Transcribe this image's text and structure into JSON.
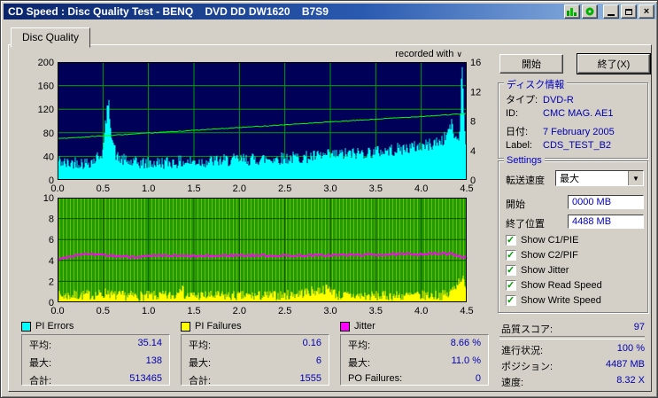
{
  "window": {
    "title": "CD Speed : Disc Quality Test - BENQ    DVD DD DW1620    B7S9"
  },
  "tab": {
    "label": "Disc Quality"
  },
  "chart_note": "recorded with",
  "buttons": {
    "start": "開始",
    "exit": "終了(X)"
  },
  "disc_info": {
    "title": "ディスク情報",
    "rows": [
      {
        "label": "タイプ:",
        "value": "DVD-R"
      },
      {
        "label": "ID:",
        "value": "CMC MAG. AE1"
      },
      {
        "label": "日付:",
        "value": "7 February 2005"
      },
      {
        "label": "Label:",
        "value": "CDS_TEST_B2"
      }
    ]
  },
  "settings": {
    "title": "Settings",
    "speed_label": "転送速度",
    "speed_value": "最大",
    "start_label": "開始",
    "start_value": "0000 MB",
    "end_label": "終了位置",
    "end_value": "4488 MB",
    "checkboxes": [
      {
        "label": "Show C1/PIE",
        "checked": true
      },
      {
        "label": "Show C2/PIF",
        "checked": true
      },
      {
        "label": "Show Jitter",
        "checked": true
      },
      {
        "label": "Show Read Speed",
        "checked": true
      },
      {
        "label": "Show Write Speed",
        "checked": true
      }
    ]
  },
  "status": {
    "quality_label": "品質スコア:",
    "quality_value": "97",
    "progress_label": "進行状況:",
    "progress_value": "100 %",
    "position_label": "ポジション:",
    "position_value": "4487 MB",
    "speed_label": "速度:",
    "speed_value": "8.32 X"
  },
  "stats": [
    {
      "name": "PI Errors",
      "color": "#00ffff",
      "rows": [
        {
          "label": "平均:",
          "value": "35.14"
        },
        {
          "label": "最大:",
          "value": "138"
        },
        {
          "label": "合計:",
          "value": "513465"
        }
      ]
    },
    {
      "name": "PI Failures",
      "color": "#ffff00",
      "rows": [
        {
          "label": "平均:",
          "value": "0.16"
        },
        {
          "label": "最大:",
          "value": "6"
        },
        {
          "label": "合計:",
          "value": "1555"
        }
      ]
    },
    {
      "name": "Jitter",
      "color": "#ff00ff",
      "rows": [
        {
          "label": "平均:",
          "value": "8.66 %"
        },
        {
          "label": "最大:",
          "value": "11.0 %"
        },
        {
          "label": "PO Failures:",
          "value": "0"
        }
      ]
    }
  ],
  "chart_data": [
    {
      "type": "area",
      "name": "PI Errors and Write Speed vs position (GB)",
      "x_range": [
        0,
        4.5
      ],
      "x_ticks": [
        "0.0",
        "0.5",
        "1.0",
        "1.5",
        "2.0",
        "2.5",
        "3.0",
        "3.5",
        "4.0",
        "4.5"
      ],
      "y_left_range": [
        0,
        200
      ],
      "y_left_ticks": [
        0,
        40,
        80,
        120,
        160,
        200
      ],
      "y_right_range": [
        0,
        16
      ],
      "y_right_ticks": [
        0,
        4,
        8,
        12,
        16
      ],
      "colors": {
        "bg": "#000058",
        "grid": "#00a000",
        "label": "#000000"
      },
      "seed": 42,
      "series": [
        {
          "name": "PI Errors",
          "type": "spike-area",
          "color": "#00ffff",
          "noise": 11,
          "anchors": [
            [
              0,
              30
            ],
            [
              0.1,
              24
            ],
            [
              0.2,
              28
            ],
            [
              0.3,
              25
            ],
            [
              0.4,
              30
            ],
            [
              0.5,
              45
            ],
            [
              0.53,
              95
            ],
            [
              0.56,
              130
            ],
            [
              0.6,
              70
            ],
            [
              0.65,
              35
            ],
            [
              0.8,
              26
            ],
            [
              1.0,
              25
            ],
            [
              1.3,
              27
            ],
            [
              1.6,
              28
            ],
            [
              2.0,
              31
            ],
            [
              2.4,
              33
            ],
            [
              2.8,
              36
            ],
            [
              3.2,
              41
            ],
            [
              3.6,
              46
            ],
            [
              3.9,
              52
            ],
            [
              4.1,
              57
            ],
            [
              4.25,
              65
            ],
            [
              4.33,
              92
            ],
            [
              4.38,
              65
            ],
            [
              4.42,
              70
            ],
            [
              4.45,
              196
            ],
            [
              4.48,
              80
            ],
            [
              4.5,
              55
            ]
          ]
        },
        {
          "name": "Write Speed",
          "type": "line",
          "color": "#00ff00",
          "noise": 0.05,
          "range": [
            0,
            16
          ],
          "anchors": [
            [
              0,
              5.6
            ],
            [
              4.5,
              9.0
            ]
          ]
        }
      ]
    },
    {
      "type": "area",
      "name": "PI Failures and Jitter vs position (GB)",
      "x_range": [
        0,
        4.5
      ],
      "x_ticks": [
        "0.0",
        "0.5",
        "1.0",
        "1.5",
        "2.0",
        "2.5",
        "3.0",
        "3.5",
        "4.0",
        "4.5"
      ],
      "y_left_range": [
        0,
        10
      ],
      "y_left_ticks": [
        0,
        2,
        4,
        6,
        8,
        10
      ],
      "colors": {
        "bg": "#1e9c00",
        "grid": "#0c5200",
        "stripes": "#a8cf00",
        "label": "#000000"
      },
      "seed": 7,
      "series": [
        {
          "name": "PI Failures",
          "type": "spike-area",
          "color": "#ffff00",
          "noise": 0.5,
          "anchors": [
            [
              0,
              0.45
            ],
            [
              0.5,
              0.6
            ],
            [
              0.55,
              0.9
            ],
            [
              0.6,
              0.5
            ],
            [
              1.0,
              0.45
            ],
            [
              1.3,
              0.5
            ],
            [
              1.35,
              1.6
            ],
            [
              1.4,
              0.5
            ],
            [
              2.0,
              0.45
            ],
            [
              2.5,
              0.5
            ],
            [
              3.0,
              1.15
            ],
            [
              3.08,
              0.5
            ],
            [
              3.5,
              0.45
            ],
            [
              4.0,
              0.5
            ],
            [
              4.3,
              0.55
            ],
            [
              4.45,
              2.3
            ],
            [
              4.5,
              0.7
            ]
          ]
        },
        {
          "name": "Jitter",
          "type": "line",
          "color": "#ff00ff",
          "noise": 0.1,
          "width": 2,
          "anchors": [
            [
              0,
              4.15
            ],
            [
              0.25,
              4.6
            ],
            [
              0.5,
              4.5
            ],
            [
              0.8,
              4.35
            ],
            [
              1.2,
              4.45
            ],
            [
              1.6,
              4.4
            ],
            [
              2.0,
              4.5
            ],
            [
              2.5,
              4.45
            ],
            [
              3.0,
              4.5
            ],
            [
              3.5,
              4.55
            ],
            [
              3.9,
              4.6
            ],
            [
              4.2,
              4.65
            ],
            [
              4.35,
              4.6
            ],
            [
              4.5,
              4.25
            ]
          ]
        }
      ]
    }
  ]
}
